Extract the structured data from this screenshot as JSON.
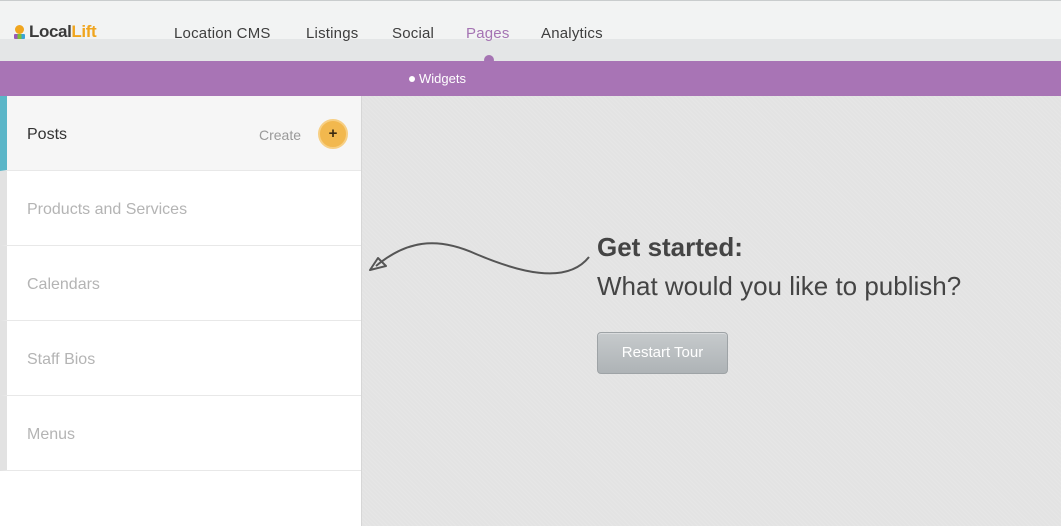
{
  "brand": {
    "logo_part1": "Local",
    "logo_part2": "Lift"
  },
  "nav": {
    "items": [
      {
        "label": "Location CMS"
      },
      {
        "label": "Listings"
      },
      {
        "label": "Social"
      },
      {
        "label": "Pages",
        "active": true
      },
      {
        "label": "Analytics"
      }
    ]
  },
  "subnav": {
    "items": [
      {
        "label": "Widgets"
      }
    ]
  },
  "sidebar": {
    "items": [
      {
        "label": "Posts",
        "active": true
      },
      {
        "label": "Products and Services"
      },
      {
        "label": "Calendars"
      },
      {
        "label": "Staff Bios"
      },
      {
        "label": "Menus"
      }
    ],
    "create_label": "Create",
    "create_button": "+"
  },
  "main": {
    "heading": "Get started:",
    "subheading": "What would you like to publish?",
    "restart_button": "Restart Tour"
  },
  "colors": {
    "accent": "#a874b5",
    "active_indicator": "#5bb6c8",
    "create_button": "#f2b84e"
  }
}
